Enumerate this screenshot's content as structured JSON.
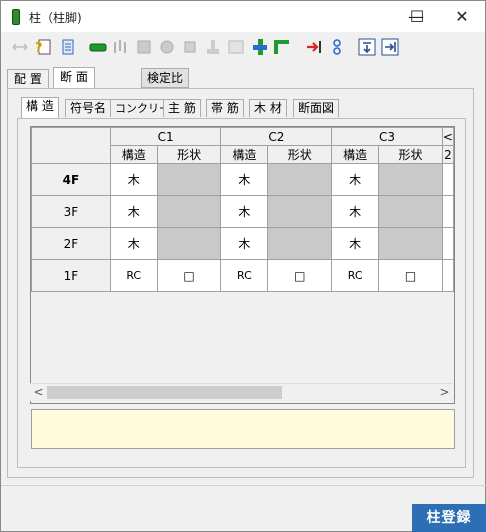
{
  "window": {
    "title": "柱（柱脚)",
    "minimize_glyph": "—",
    "maximize_glyph": "☐",
    "close_glyph": "✕"
  },
  "toolbar": {
    "icons": [
      "move-icon",
      "help-icon",
      "document-icon",
      "beam-icon",
      "column-icon",
      "wall-icon",
      "circle-icon",
      "box-icon",
      "pedestal-icon",
      "panel-icon",
      "joint-icon",
      "corner-icon",
      "arrow-right-icon",
      "link-icon",
      "down-arrow-icon",
      "right-arrow-icon"
    ]
  },
  "top_tabs": [
    {
      "label": "配 置"
    },
    {
      "label": "断 面"
    }
  ],
  "kentei_label": "検定比",
  "sub_tabs": [
    {
      "label": "構 造"
    },
    {
      "label": "符号名"
    },
    {
      "label": "コンクリート"
    },
    {
      "label": "主 筋"
    },
    {
      "label": "帯 筋"
    },
    {
      "label": "木 材"
    },
    {
      "label": "断面図"
    }
  ],
  "grid": {
    "columns": [
      "C1",
      "C2",
      "C3"
    ],
    "partial_col_header": "<",
    "partial_sub_header": "2",
    "sub_headers": [
      "構造",
      "形状"
    ],
    "rows": [
      {
        "floor": "4F",
        "cells": [
          [
            "木",
            ""
          ],
          [
            "木",
            ""
          ],
          [
            "木",
            ""
          ]
        ]
      },
      {
        "floor": "3F",
        "cells": [
          [
            "木",
            ""
          ],
          [
            "木",
            ""
          ],
          [
            "木",
            ""
          ]
        ]
      },
      {
        "floor": "2F",
        "cells": [
          [
            "木",
            ""
          ],
          [
            "木",
            ""
          ],
          [
            "木",
            ""
          ]
        ]
      },
      {
        "floor": "1F",
        "cells": [
          [
            "RC",
            "□"
          ],
          [
            "RC",
            "□"
          ],
          [
            "RC",
            "□"
          ]
        ]
      }
    ]
  },
  "scrollbar": {
    "left": "<",
    "right": ">"
  },
  "register_button": "柱登録"
}
